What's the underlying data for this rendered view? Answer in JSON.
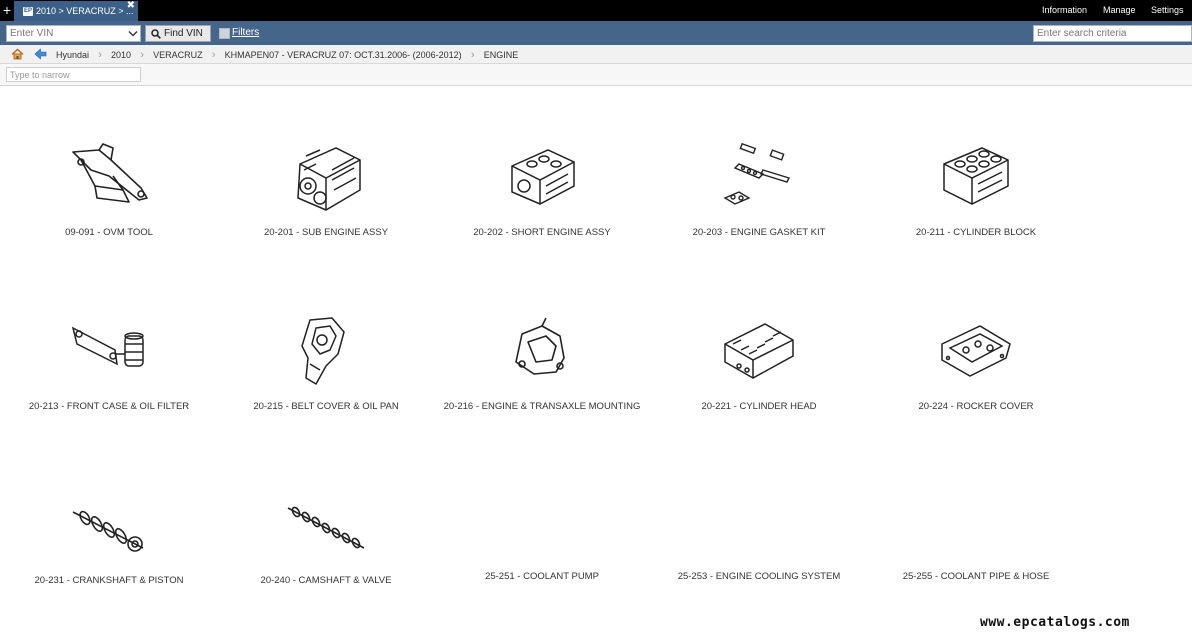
{
  "app": {
    "new_tab": "+",
    "tab_title": "2010 > VERACRUZ > ...",
    "tab_close": "✖",
    "menu": [
      "Information",
      "Manage",
      "Settings"
    ]
  },
  "search": {
    "vin_placeholder": "Enter VIN",
    "find_label": "Find VIN",
    "filters_label": "Filters",
    "criteria_placeholder": "Enter search criteria"
  },
  "breadcrumb": [
    "Hyundai",
    "2010",
    "VERACRUZ",
    "KHMAPEN07 - VERACRUZ 07: OCT.31.2006- (2006-2012)",
    "ENGINE"
  ],
  "narrow_placeholder": "Type to narrow",
  "parts": [
    {
      "label": "09-091 - OVM TOOL",
      "icon": "jack-icon"
    },
    {
      "label": "20-201 - SUB ENGINE ASSY",
      "icon": "engine-assembly-icon"
    },
    {
      "label": "20-202 - SHORT ENGINE ASSY",
      "icon": "short-engine-icon"
    },
    {
      "label": "20-203 - ENGINE GASKET KIT",
      "icon": "gasket-kit-icon"
    },
    {
      "label": "20-211 - CYLINDER BLOCK",
      "icon": "cylinder-block-icon"
    },
    {
      "label": "20-213 - FRONT CASE & OIL FILTER",
      "icon": "oil-filter-icon"
    },
    {
      "label": "20-215 - BELT COVER & OIL PAN",
      "icon": "belt-cover-icon"
    },
    {
      "label": "20-216 - ENGINE & TRANSAXLE MOUNTING",
      "icon": "mounting-bracket-icon"
    },
    {
      "label": "20-221 - CYLINDER HEAD",
      "icon": "cylinder-head-icon"
    },
    {
      "label": "20-224 - ROCKER COVER",
      "icon": "rocker-cover-icon"
    },
    {
      "label": "20-231 - CRANKSHAFT & PISTON",
      "icon": "crankshaft-icon"
    },
    {
      "label": "20-240 - CAMSHAFT & VALVE",
      "icon": "camshaft-icon"
    },
    {
      "label": "25-251 - COOLANT PUMP",
      "icon": ""
    },
    {
      "label": "25-253 - ENGINE COOLING SYSTEM",
      "icon": ""
    },
    {
      "label": "25-255 - COOLANT PIPE & HOSE",
      "icon": ""
    }
  ],
  "watermark": "www.epcatalogs.com",
  "colors": {
    "tabbar": "#000000",
    "accent": "#46658b",
    "tab": "#3b5f86"
  }
}
